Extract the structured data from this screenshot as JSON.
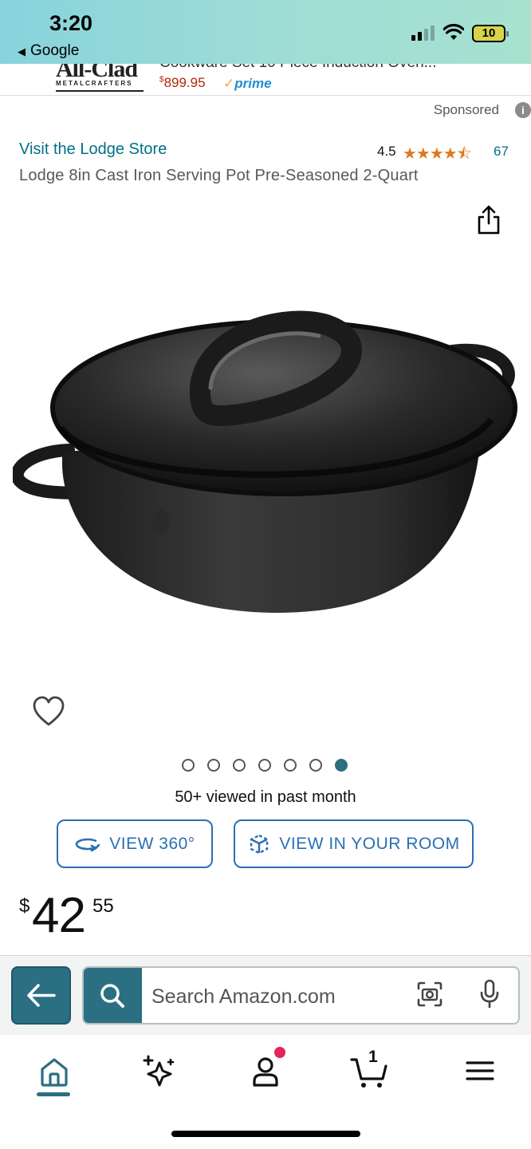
{
  "status_bar": {
    "time": "3:20",
    "back_app": "Google",
    "battery": "10"
  },
  "ad": {
    "brand": "All-Clad",
    "brand_sub": "METALCRAFTERS",
    "title": "Cookware Set 10 Piece Induction Oven...",
    "price_symbol": "$",
    "price": "899.95",
    "prime": "prime"
  },
  "sponsored_label": "Sponsored",
  "product": {
    "store_link": "Visit the Lodge Store",
    "rating": "4.5",
    "stars": "★★★★⯪",
    "rating_count": "67",
    "title": "Lodge 8in Cast Iron Serving Pot Pre-Seasoned 2-Quart",
    "image_count": 7,
    "active_image": 7,
    "viewed": "50+ viewed in past month",
    "price": {
      "currency": "$",
      "whole": "42",
      "fraction": "55"
    }
  },
  "buttons": {
    "view_360": "VIEW 360°",
    "view_in_room": "VIEW IN YOUR ROOM"
  },
  "search": {
    "placeholder": "Search Amazon.com"
  },
  "tabbar": {
    "cart_count": "1"
  },
  "colors": {
    "teal": "#2b6f82",
    "link": "#007185",
    "star": "#de7921",
    "button_border": "#2a6fb2",
    "price_red": "#b12704"
  }
}
